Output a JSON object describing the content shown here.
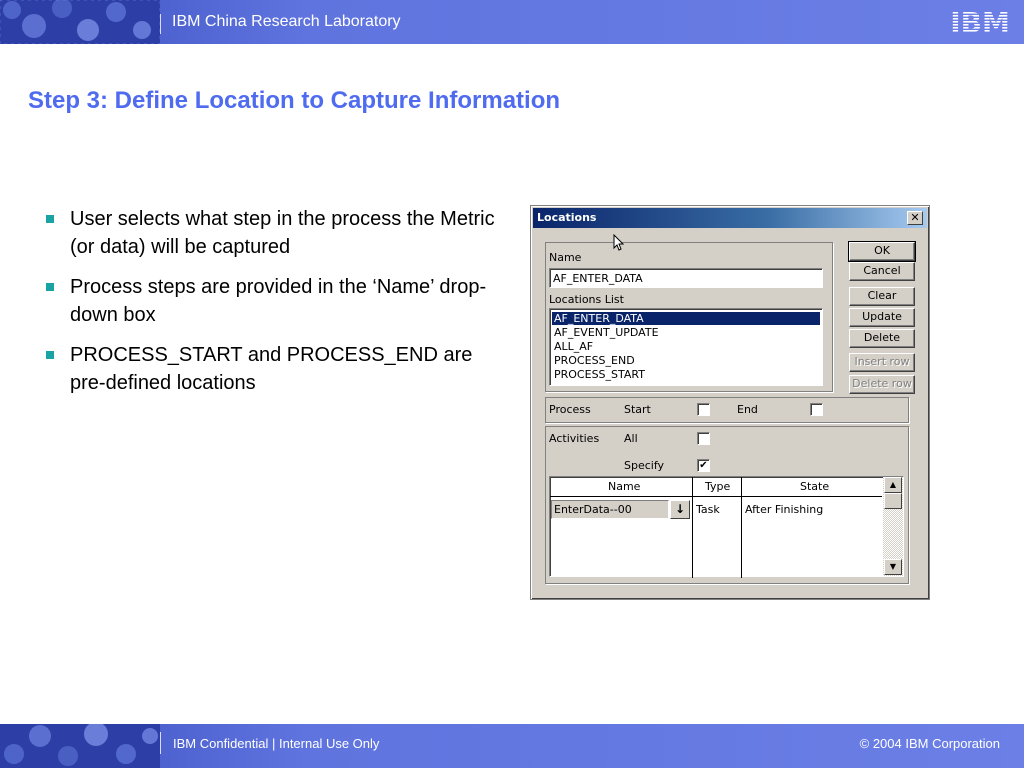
{
  "header": {
    "title": "IBM China Research Laboratory",
    "logo": "IBM"
  },
  "slide": {
    "title": "Step 3:  Define Location to Capture Information",
    "bullets": [
      "User selects what step in the process the Metric (or data) will be captured",
      "Process steps are provided in the ‘Name’ drop-down box",
      "PROCESS_START and PROCESS_END are pre-defined locations"
    ]
  },
  "dialog": {
    "title": "Locations",
    "close_glyph": "✕",
    "name_label": "Name",
    "name_value": "AF_ENTER_DATA",
    "locations_list_label": "Locations List",
    "locations": [
      "AF_ENTER_DATA",
      "AF_EVENT_UPDATE",
      "ALL_AF",
      "PROCESS_END",
      "PROCESS_START"
    ],
    "selected_location": "AF_ENTER_DATA",
    "buttons": {
      "ok": "OK",
      "cancel": "Cancel",
      "clear": "Clear",
      "update": "Update",
      "delete": "Delete",
      "insert_row": "Insert row",
      "delete_row": "Delete row"
    },
    "process": {
      "label": "Process",
      "start_label": "Start",
      "start_checked": false,
      "end_label": "End",
      "end_checked": false
    },
    "activities": {
      "label": "Activities",
      "all_label": "All",
      "all_checked": false,
      "specify_label": "Specify",
      "specify_checked": true
    },
    "grid": {
      "columns": [
        "Name",
        "Type",
        "State"
      ],
      "rows": [
        {
          "name": "EnterData--00",
          "type": "Task",
          "state": "After Finishing"
        }
      ]
    },
    "check_glyph": "✔",
    "dropdown_glyph": "↓",
    "scroll_up_glyph": "▲",
    "scroll_down_glyph": "▼"
  },
  "footer": {
    "left": "IBM Confidential |  Internal Use Only",
    "right": "© 2004 IBM Corporation"
  },
  "colors": {
    "band": "#5f74de",
    "title": "#4f6bef",
    "bullet": "#1aa3a3"
  }
}
